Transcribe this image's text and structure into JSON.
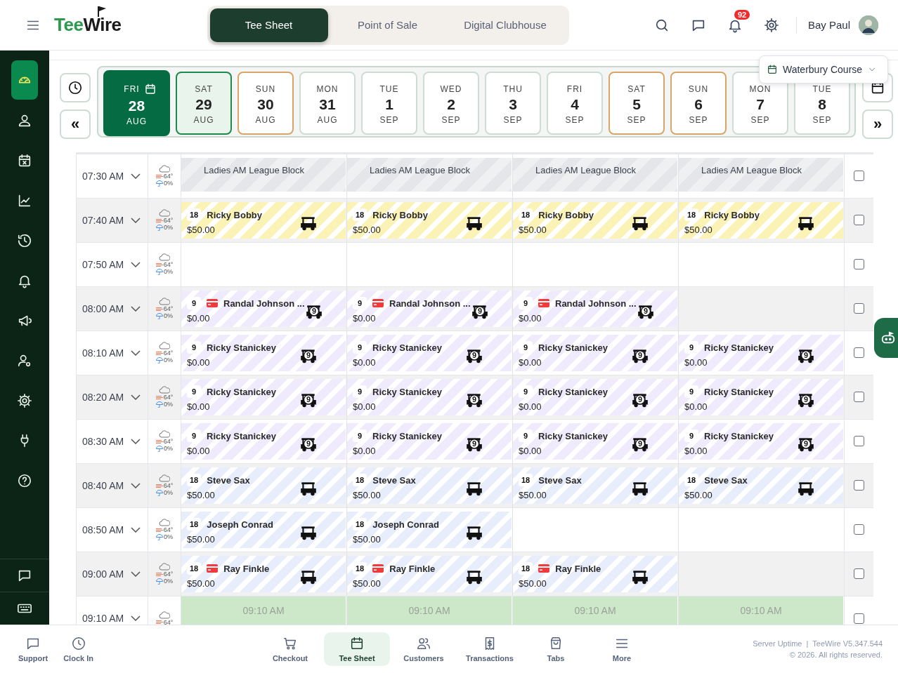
{
  "header": {
    "logo_left": "Tee",
    "logo_right": "Wire",
    "tabs": [
      {
        "label": "Tee Sheet",
        "selected": true
      },
      {
        "label": "Point of Sale",
        "selected": false
      },
      {
        "label": "Digital Clubhouse",
        "selected": false
      }
    ],
    "notification_count": "92",
    "user_name": "Bay Paul"
  },
  "sidebar": {
    "items": [
      {
        "selected": true
      },
      {
        "selected": false
      },
      {
        "selected": false
      },
      {
        "selected": false
      },
      {
        "selected": false
      },
      {
        "selected": false
      },
      {
        "selected": false
      },
      {
        "selected": false
      },
      {
        "selected": false
      },
      {
        "selected": false
      },
      {
        "selected": false
      }
    ]
  },
  "course": "Waterbury Course",
  "date_nav": {
    "prev": "«",
    "next": "»"
  },
  "dates": [
    {
      "day": "FRI",
      "date": "28",
      "month": "AUG",
      "selected": true,
      "today": false,
      "weekend": false
    },
    {
      "day": "SAT",
      "date": "29",
      "month": "AUG",
      "selected": false,
      "today": true,
      "weekend": true
    },
    {
      "day": "SUN",
      "date": "30",
      "month": "AUG",
      "selected": false,
      "today": false,
      "weekend": true
    },
    {
      "day": "MON",
      "date": "31",
      "month": "AUG",
      "selected": false,
      "today": false,
      "weekend": false
    },
    {
      "day": "TUE",
      "date": "1",
      "month": "SEP",
      "selected": false,
      "today": false,
      "weekend": false
    },
    {
      "day": "WED",
      "date": "2",
      "month": "SEP",
      "selected": false,
      "today": false,
      "weekend": false
    },
    {
      "day": "THU",
      "date": "3",
      "month": "SEP",
      "selected": false,
      "today": false,
      "weekend": false
    },
    {
      "day": "FRI",
      "date": "4",
      "month": "SEP",
      "selected": false,
      "today": false,
      "weekend": false
    },
    {
      "day": "SAT",
      "date": "5",
      "month": "SEP",
      "selected": false,
      "today": false,
      "weekend": true
    },
    {
      "day": "SUN",
      "date": "6",
      "month": "SEP",
      "selected": false,
      "today": false,
      "weekend": true
    },
    {
      "day": "MON",
      "date": "7",
      "month": "SEP",
      "selected": false,
      "today": false,
      "weekend": false
    },
    {
      "day": "TUE",
      "date": "8",
      "month": "SEP",
      "selected": false,
      "today": false,
      "weekend": false
    }
  ],
  "rows": [
    {
      "time": "07:30 AM",
      "temp": "64°",
      "precip": "0%",
      "checked": false,
      "slots": [
        {
          "kind": "block",
          "label": "Ladies AM League Block"
        },
        {
          "kind": "block",
          "label": "Ladies AM League Block"
        },
        {
          "kind": "block",
          "label": "Ladies AM League Block"
        },
        {
          "kind": "block",
          "label": "Ladies AM League Block"
        }
      ]
    },
    {
      "time": "07:40 AM",
      "temp": "64°",
      "precip": "0%",
      "checked": false,
      "slots": [
        {
          "kind": "booking",
          "holes": "18",
          "card": false,
          "name": "Ricky Bobby",
          "price": "$50.00",
          "color": "#fbf3b5"
        },
        {
          "kind": "booking",
          "holes": "18",
          "card": false,
          "name": "Ricky Bobby",
          "price": "$50.00",
          "color": "#fbf3b5"
        },
        {
          "kind": "booking",
          "holes": "18",
          "card": false,
          "name": "Ricky Bobby",
          "price": "$50.00",
          "color": "#fbf3b5"
        },
        {
          "kind": "booking",
          "holes": "18",
          "card": false,
          "name": "Ricky Bobby",
          "price": "$50.00",
          "color": "#fbf3b5"
        }
      ]
    },
    {
      "time": "07:50 AM",
      "temp": "64°",
      "precip": "0%",
      "checked": false,
      "slots": [
        {
          "kind": "empty"
        },
        {
          "kind": "empty"
        },
        {
          "kind": "empty"
        },
        {
          "kind": "empty"
        }
      ]
    },
    {
      "time": "08:00 AM",
      "temp": "64°",
      "precip": "0%",
      "checked": false,
      "slots": [
        {
          "kind": "booking",
          "holes": "9",
          "card": true,
          "name": "Randal Johnson ...",
          "price": "$0.00",
          "cart_label": "9",
          "color": "#efeafc"
        },
        {
          "kind": "booking",
          "holes": "9",
          "card": true,
          "name": "Randal Johnson ...",
          "price": "$0.00",
          "cart_label": "9",
          "color": "#efeafc"
        },
        {
          "kind": "booking",
          "holes": "9",
          "card": true,
          "name": "Randal Johnson ...",
          "price": "$0.00",
          "cart_label": "9",
          "color": "#efeafc"
        },
        {
          "kind": "empty"
        }
      ]
    },
    {
      "time": "08:10 AM",
      "temp": "64°",
      "precip": "0%",
      "checked": false,
      "slots": [
        {
          "kind": "booking",
          "holes": "9",
          "card": false,
          "name": "Ricky Stanickey",
          "price": "$0.00",
          "cart_label": "9",
          "color": "#efeafc"
        },
        {
          "kind": "booking",
          "holes": "9",
          "card": false,
          "name": "Ricky Stanickey",
          "price": "$0.00",
          "cart_label": "9",
          "color": "#efeafc"
        },
        {
          "kind": "booking",
          "holes": "9",
          "card": false,
          "name": "Ricky Stanickey",
          "price": "$0.00",
          "cart_label": "9",
          "color": "#efeafc"
        },
        {
          "kind": "booking",
          "holes": "9",
          "card": false,
          "name": "Ricky Stanickey",
          "price": "$0.00",
          "cart_label": "9",
          "color": "#efeafc"
        }
      ]
    },
    {
      "time": "08:20 AM",
      "temp": "64°",
      "precip": "0%",
      "checked": false,
      "slots": [
        {
          "kind": "booking",
          "holes": "9",
          "card": false,
          "name": "Ricky Stanickey",
          "price": "$0.00",
          "cart_label": "9",
          "color": "#efeafc"
        },
        {
          "kind": "booking",
          "holes": "9",
          "card": false,
          "name": "Ricky Stanickey",
          "price": "$0.00",
          "cart_label": "9",
          "color": "#efeafc"
        },
        {
          "kind": "booking",
          "holes": "9",
          "card": false,
          "name": "Ricky Stanickey",
          "price": "$0.00",
          "cart_label": "9",
          "color": "#efeafc"
        },
        {
          "kind": "booking",
          "holes": "9",
          "card": false,
          "name": "Ricky Stanickey",
          "price": "$0.00",
          "cart_label": "9",
          "color": "#efeafc"
        }
      ]
    },
    {
      "time": "08:30 AM",
      "temp": "64°",
      "precip": "0%",
      "checked": false,
      "slots": [
        {
          "kind": "booking",
          "holes": "9",
          "card": false,
          "name": "Ricky Stanickey",
          "price": "$0.00",
          "cart_label": "9",
          "color": "#efeafc"
        },
        {
          "kind": "booking",
          "holes": "9",
          "card": false,
          "name": "Ricky Stanickey",
          "price": "$0.00",
          "cart_label": "9",
          "color": "#efeafc"
        },
        {
          "kind": "booking",
          "holes": "9",
          "card": false,
          "name": "Ricky Stanickey",
          "price": "$0.00",
          "cart_label": "9",
          "color": "#efeafc"
        },
        {
          "kind": "booking",
          "holes": "9",
          "card": false,
          "name": "Ricky Stanickey",
          "price": "$0.00",
          "cart_label": "9",
          "color": "#efeafc"
        }
      ]
    },
    {
      "time": "08:40 AM",
      "temp": "64°",
      "precip": "0%",
      "checked": false,
      "slots": [
        {
          "kind": "booking",
          "holes": "18",
          "card": false,
          "name": "Steve Sax",
          "price": "$50.00",
          "color": "#e8edfb"
        },
        {
          "kind": "booking",
          "holes": "18",
          "card": false,
          "name": "Steve Sax",
          "price": "$50.00",
          "color": "#e8edfb"
        },
        {
          "kind": "booking",
          "holes": "18",
          "card": false,
          "name": "Steve Sax",
          "price": "$50.00",
          "color": "#e8edfb"
        },
        {
          "kind": "booking",
          "holes": "18",
          "card": false,
          "name": "Steve Sax",
          "price": "$50.00",
          "color": "#e8edfb"
        }
      ]
    },
    {
      "time": "08:50 AM",
      "temp": "64°",
      "precip": "0%",
      "checked": false,
      "slots": [
        {
          "kind": "booking",
          "holes": "18",
          "card": false,
          "name": "Joseph Conrad",
          "price": "$50.00",
          "color": "#e8edfb"
        },
        {
          "kind": "booking",
          "holes": "18",
          "card": false,
          "name": "Joseph Conrad",
          "price": "$50.00",
          "color": "#e8edfb"
        },
        {
          "kind": "empty"
        },
        {
          "kind": "empty"
        }
      ]
    },
    {
      "time": "09:00 AM",
      "temp": "64°",
      "precip": "0%",
      "checked": false,
      "slots": [
        {
          "kind": "booking",
          "holes": "18",
          "card": true,
          "name": "Ray Finkle",
          "price": "$50.00",
          "color": "#e8edfb"
        },
        {
          "kind": "booking",
          "holes": "18",
          "card": true,
          "name": "Ray Finkle",
          "price": "$50.00",
          "color": "#e8edfb"
        },
        {
          "kind": "booking",
          "holes": "18",
          "card": true,
          "name": "Ray Finkle",
          "price": "$50.00",
          "color": "#e8edfb"
        },
        {
          "kind": "empty"
        }
      ]
    },
    {
      "time": "09:10 AM",
      "temp": "64°",
      "checked": false,
      "slots": [
        {
          "kind": "open",
          "label": "09:10 AM"
        },
        {
          "kind": "open",
          "label": "09:10 AM"
        },
        {
          "kind": "open",
          "label": "09:10 AM"
        },
        {
          "kind": "open",
          "label": "09:10 AM"
        }
      ]
    }
  ],
  "bottom_nav": {
    "left": [
      {
        "label": "Support",
        "selected": false
      },
      {
        "label": "Clock In",
        "selected": false
      }
    ],
    "center": [
      {
        "label": "Checkout",
        "selected": false
      },
      {
        "label": "Tee Sheet",
        "selected": true
      },
      {
        "label": "Customers",
        "selected": false
      },
      {
        "label": "Transactions",
        "selected": false
      },
      {
        "label": "Tabs",
        "selected": false
      },
      {
        "label": "More",
        "selected": false
      }
    ]
  },
  "footer": {
    "uptime": "Server Uptime",
    "separator": "|",
    "version": "TeeWire V5.347.544",
    "copyright": "© 2026. All rights reserved."
  }
}
